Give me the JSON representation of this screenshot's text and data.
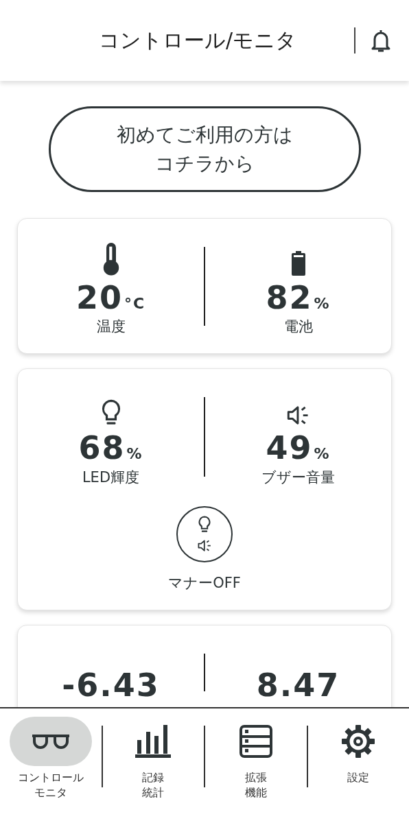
{
  "header": {
    "title": "コントロール/モニタ"
  },
  "intro_button": {
    "lines": [
      "初めてご利用の方は",
      "コチラから"
    ]
  },
  "cards": [
    {
      "metrics": [
        {
          "value": "20",
          "unit": "°C",
          "label": "温度"
        },
        {
          "value": "82",
          "unit": "%",
          "label": "電池"
        }
      ]
    },
    {
      "metrics": [
        {
          "value": "68",
          "unit": "%",
          "label": "LED輝度"
        },
        {
          "value": "49",
          "unit": "%",
          "label": "ブザー音量"
        }
      ],
      "manner": {
        "label": "マナーOFF"
      }
    },
    {
      "metrics": [
        {
          "value": "-6.43"
        },
        {
          "value": "8.47"
        }
      ]
    }
  ],
  "nav": [
    {
      "lines": [
        "コントロール",
        "モニタ"
      ],
      "selected": true
    },
    {
      "lines": [
        "記録",
        "統計"
      ],
      "selected": false
    },
    {
      "lines": [
        "拡張",
        "機能"
      ],
      "selected": false
    },
    {
      "lines": [
        "設定"
      ],
      "selected": false
    }
  ]
}
